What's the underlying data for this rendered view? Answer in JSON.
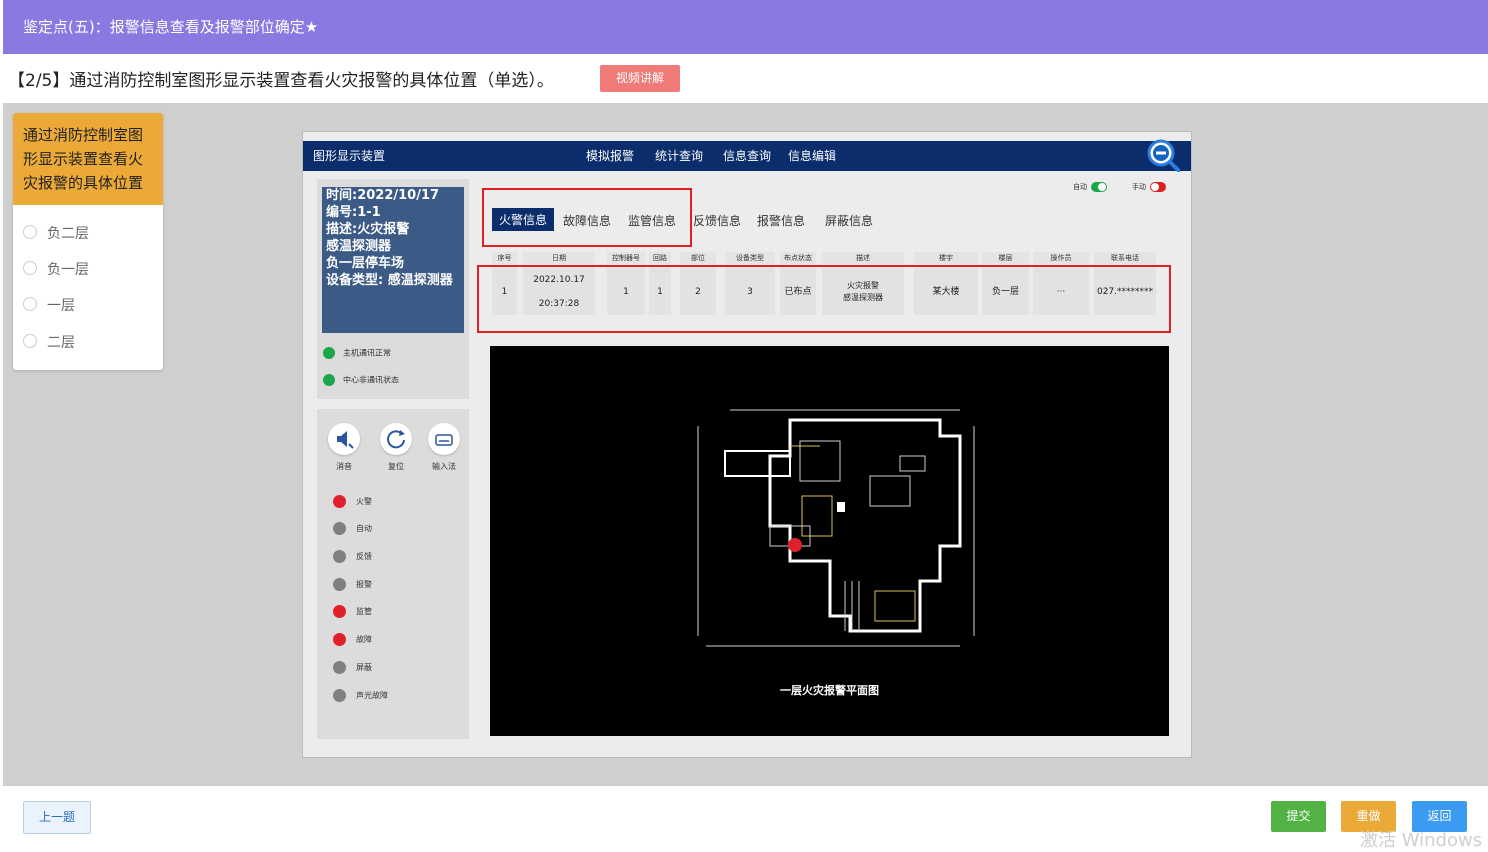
{
  "header": {
    "title": "鉴定点(五)：报警信息查看及报警部位确定★"
  },
  "question": {
    "text": "【2/5】通过消防控制室图形显示装置查看火灾报警的具体位置（单选）。",
    "video_button": "视频讲解"
  },
  "card": {
    "prompt": "通过消防控制室图形显示装置查看火灾报警的具体位置",
    "options": [
      "负二层",
      "负一层",
      "一层",
      "二层"
    ]
  },
  "sim": {
    "title": "图形显示装置",
    "menu": [
      "模拟报警",
      "统计查询",
      "信息查询",
      "信息编辑"
    ],
    "info": [
      "时间:2022/10/17",
      "编号:1-1",
      "描述:火灾报警",
      "感温探测器",
      "负一层停车场",
      "设备类型: 感温探测器"
    ],
    "status": [
      "主机通讯正常",
      "中心非通讯状态"
    ],
    "controls": [
      "消音",
      "复位",
      "输入法"
    ],
    "leds": [
      {
        "label": "火警",
        "color": "#e0202a"
      },
      {
        "label": "自动",
        "color": "#808080"
      },
      {
        "label": "反馈",
        "color": "#808080"
      },
      {
        "label": "报警",
        "color": "#808080"
      },
      {
        "label": "监管",
        "color": "#e0202a"
      },
      {
        "label": "故障",
        "color": "#e0202a"
      },
      {
        "label": "屏蔽",
        "color": "#808080"
      },
      {
        "label": "声光故障",
        "color": "#808080"
      }
    ],
    "tabs": [
      "火警信息",
      "故障信息",
      "监管信息",
      "反馈信息",
      "报警信息",
      "屏蔽信息"
    ],
    "toggles": {
      "auto": "自动",
      "manual": "手动"
    },
    "table": {
      "headers": [
        "序号",
        "日期",
        "控制器号",
        "回路",
        "部位",
        "设备类型",
        "布点状态",
        "描述",
        "楼宇",
        "楼层",
        "操作员",
        "联系电话"
      ],
      "row": {
        "seq": "1",
        "date": "2022.10.17",
        "time": "20:37:28",
        "controller": "1",
        "loop": "1",
        "part": "2",
        "device_type": "3",
        "status": "已布点",
        "desc1": "火灾报警",
        "desc2": "感温探测器",
        "building": "某大楼",
        "floor": "负一层",
        "operator": "···",
        "phone": "027.********"
      }
    },
    "floorplan_caption": "一层火灾报警平面图"
  },
  "bottom": {
    "prev": "上一题",
    "submit": "提交",
    "redo": "重做",
    "back": "返回"
  },
  "watermark": "激活 Windows"
}
